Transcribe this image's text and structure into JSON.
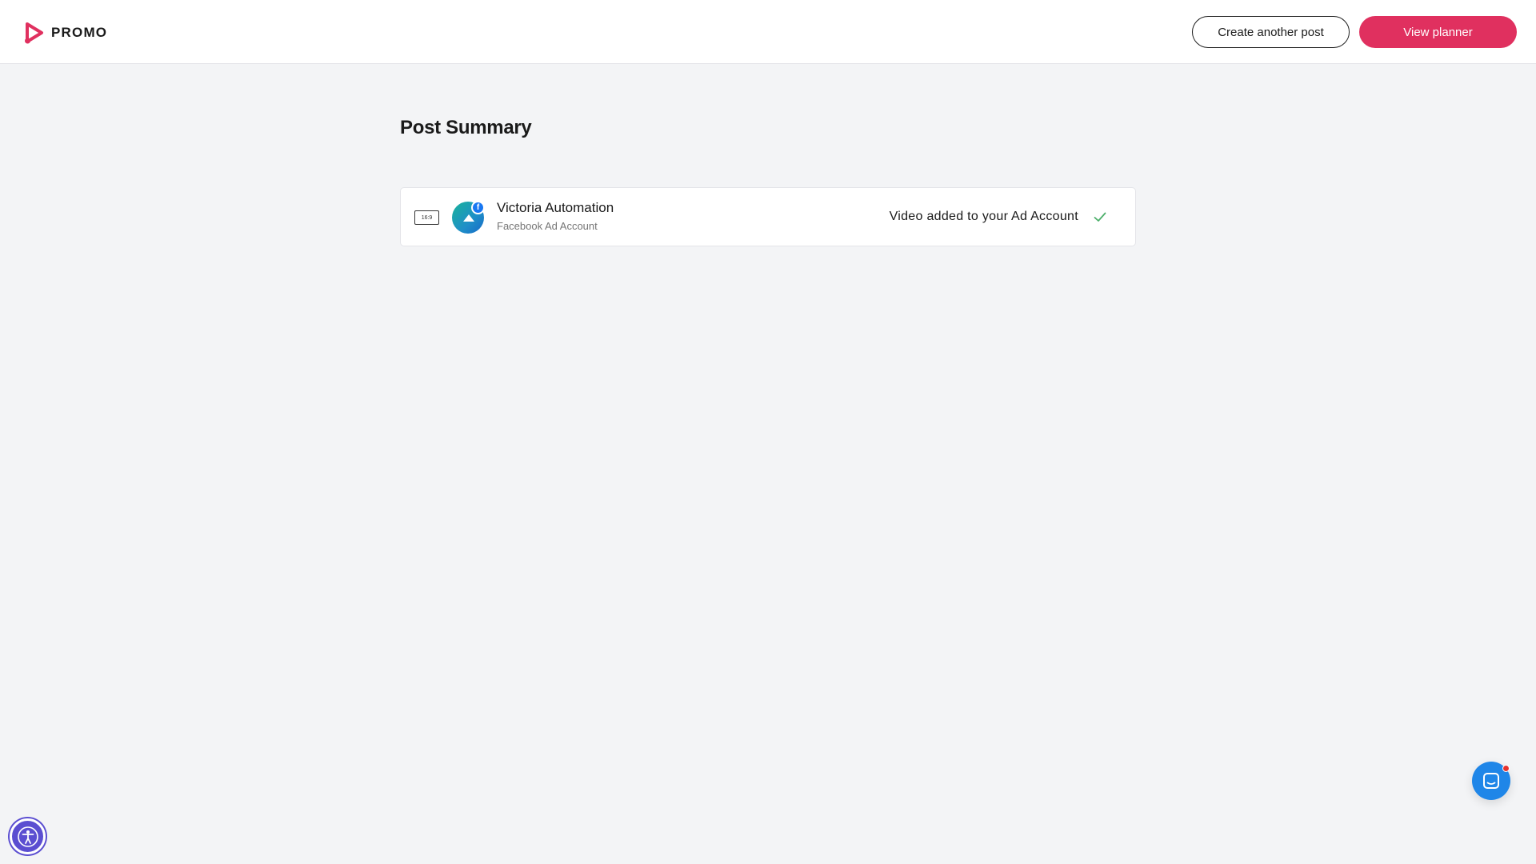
{
  "header": {
    "logo_text": "PROMO",
    "create_another_label": "Create another post",
    "view_planner_label": "View planner"
  },
  "main": {
    "title": "Post Summary",
    "posts": [
      {
        "ratio_label": "16:9",
        "account_name": "Victoria Automation",
        "account_type": "Facebook Ad Account",
        "platform_badge": "f",
        "status": "Video added to your Ad Account"
      }
    ]
  },
  "icons": {
    "logo": "promo-logo-icon",
    "ratio": "aspect-ratio-icon",
    "platform": "facebook-icon",
    "status": "check-icon",
    "accessibility": "accessibility-icon",
    "chat": "chat-icon"
  },
  "colors": {
    "brand": "#e0305f",
    "success": "#4caf6a",
    "facebook": "#1877f2",
    "chat": "#1f86e8",
    "accessibility": "#5b4ed1",
    "notification": "#e5322d"
  }
}
